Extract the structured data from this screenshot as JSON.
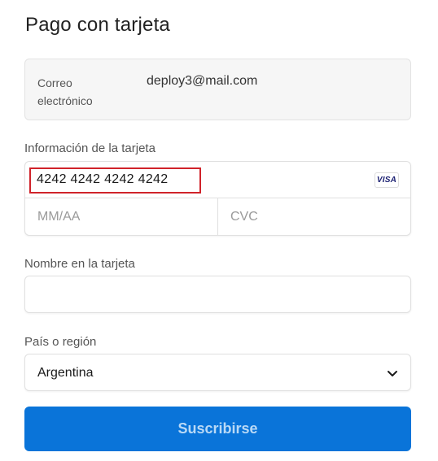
{
  "header": {
    "title": "Pago con tarjeta"
  },
  "email": {
    "label": "Correo electrónico",
    "value": "deploy3@mail.com"
  },
  "card": {
    "section_label": "Información de la tarjeta",
    "number_value": "4242 4242 4242 4242",
    "brand": "VISA",
    "expiry_placeholder": "MM/AA",
    "cvc_placeholder": "CVC"
  },
  "name": {
    "label": "Nombre en la tarjeta",
    "value": ""
  },
  "country": {
    "label": "País o región",
    "selected": "Argentina",
    "icon": "chevron-down-icon"
  },
  "submit": {
    "label": "Suscribirse"
  },
  "colors": {
    "primary": "#0a74d9",
    "highlight": "#d0232a",
    "visa_blue": "#1a1f71"
  }
}
